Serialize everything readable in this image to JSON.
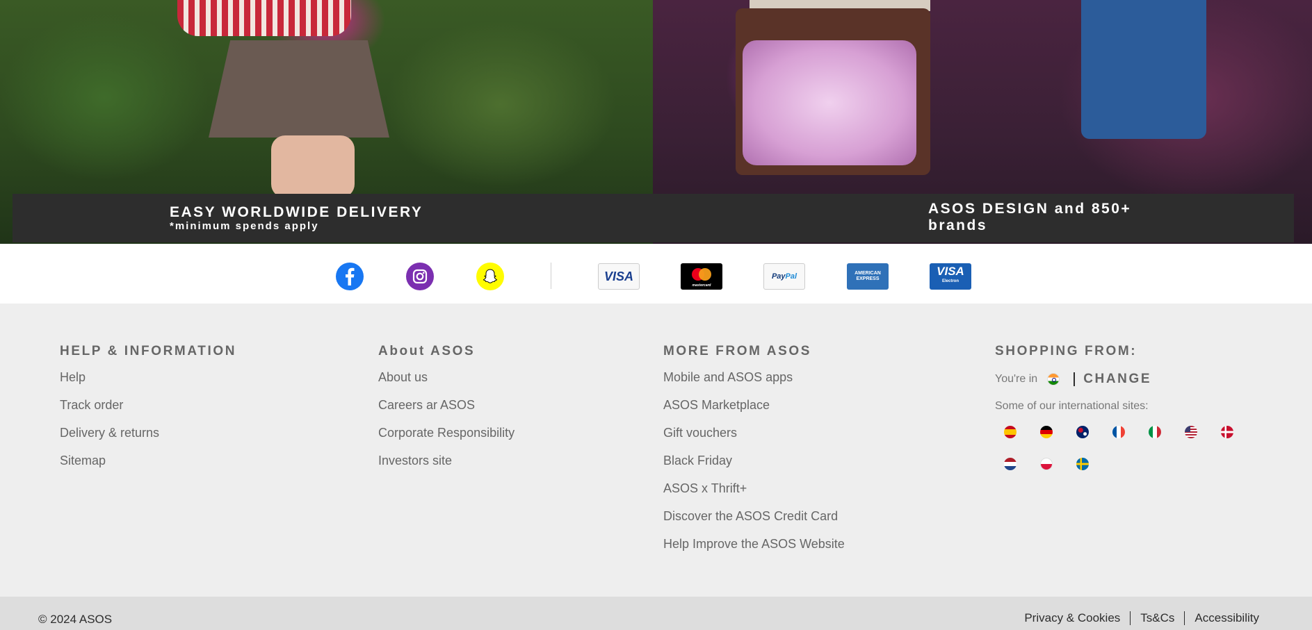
{
  "hero": {
    "left_title": "EASY WORLDWIDE DELIVERY",
    "left_sub": "*minimum spends apply",
    "right_title": "ASOS DESIGN and 850+ brands"
  },
  "social": [
    "facebook-icon",
    "instagram-icon",
    "snapchat-icon"
  ],
  "payments": {
    "visa": "VISA",
    "mastercard": "mastercard",
    "paypal_a": "Pay",
    "paypal_b": "Pal",
    "amex_a": "AMERICAN",
    "amex_b": "EXPRESS",
    "visa_electron": "VISA",
    "visa_electron_sub": "Electron"
  },
  "footer": {
    "help": {
      "title": "HELP & INFORMATION",
      "links": [
        "Help",
        "Track order",
        "Delivery & returns",
        "Sitemap"
      ]
    },
    "about": {
      "title": "About ASOS",
      "links": [
        "About us",
        "Careers ar ASOS",
        "Corporate Responsibility",
        "Investors site"
      ]
    },
    "more": {
      "title": "MORE FROM ASOS",
      "links": [
        "Mobile and ASOS apps",
        "ASOS Marketplace",
        "Gift vouchers",
        "Black Friday",
        "ASOS x Thrift+",
        "Discover the ASOS Credit Card",
        "Help Improve the ASOS Website"
      ]
    },
    "shopping": {
      "title": "SHOPPING FROM:",
      "youre_in": "You're in",
      "change": "CHANGE",
      "intl_label": "Some of our international sites:",
      "flags": [
        "spain-flag-icon",
        "germany-flag-icon",
        "australia-flag-icon",
        "france-flag-icon",
        "italy-flag-icon",
        "usa-flag-icon",
        "denmark-flag-icon",
        "netherlands-flag-icon",
        "poland-flag-icon",
        "sweden-flag-icon"
      ]
    }
  },
  "bottom": {
    "copyright": "© 2024 ASOS",
    "links": [
      "Privacy & Cookies",
      "Ts&Cs",
      "Accessibility"
    ]
  },
  "colors": {
    "facebook": "#1877f2",
    "instagram": "#7b2fb0",
    "snapchat": "#fffc00",
    "banner": "#2d2d2d",
    "footer_bg": "#eeeeee"
  }
}
